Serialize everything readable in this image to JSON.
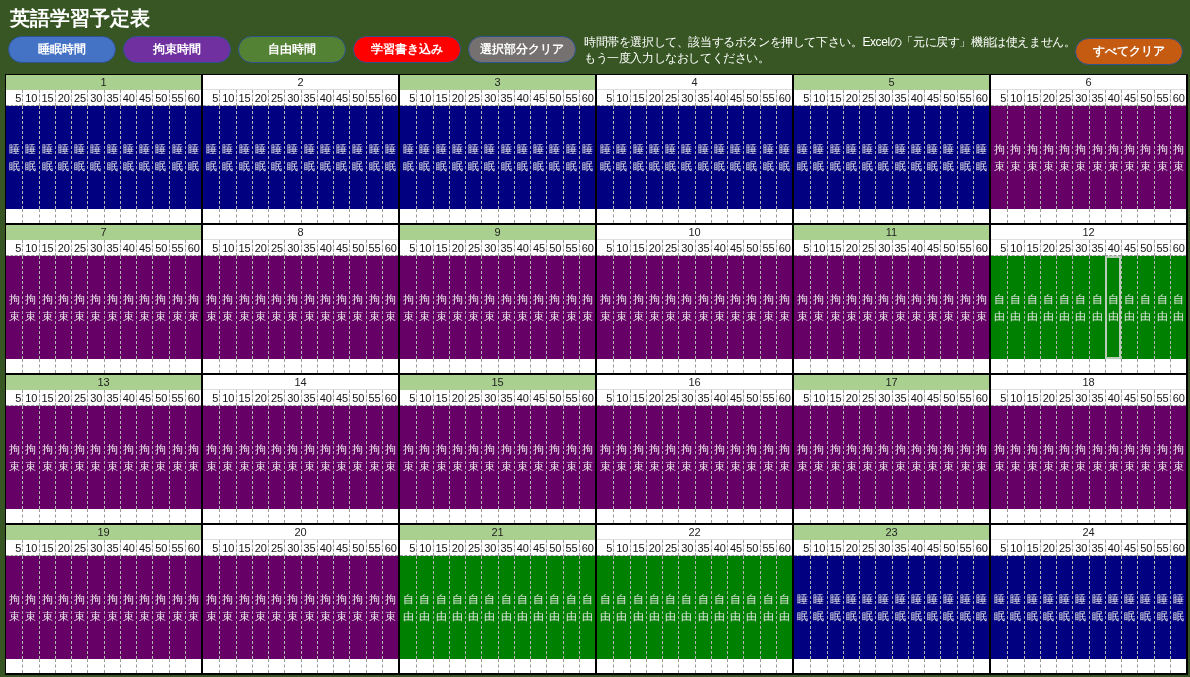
{
  "title": "英語学習予定表",
  "buttons": [
    {
      "label": "睡眠時間",
      "color": "#4472c4"
    },
    {
      "label": "拘束時間",
      "color": "#7030a0"
    },
    {
      "label": "自由時間",
      "color": "#548235"
    },
    {
      "label": "学習書き込み",
      "color": "#ff0000"
    },
    {
      "label": "選択部分クリア",
      "color": "#767171"
    }
  ],
  "instructions": [
    "時間帯を選択して、該当するボタンを押して下さい。Excelの「元に戻す」機能は使えません。",
    "もう一度入力しなおしてください。"
  ],
  "clear_all_button": {
    "label": "すべてクリア"
  },
  "hours": [
    {
      "hour": "1",
      "minutes": [
        "5",
        "10",
        "15",
        "20",
        "25",
        "30",
        "35",
        "40",
        "45",
        "50",
        "55",
        "60"
      ],
      "slots": [
        {
          "kind": "sleep",
          "text": "睡眠",
          "selected": false
        },
        {
          "kind": "sleep",
          "text": "睡眠",
          "selected": false
        },
        {
          "kind": "sleep",
          "text": "睡眠",
          "selected": false
        },
        {
          "kind": "sleep",
          "text": "睡眠",
          "selected": false
        },
        {
          "kind": "sleep",
          "text": "睡眠",
          "selected": false
        },
        {
          "kind": "sleep",
          "text": "睡眠",
          "selected": false
        },
        {
          "kind": "sleep",
          "text": "睡眠",
          "selected": false
        },
        {
          "kind": "sleep",
          "text": "睡眠",
          "selected": false
        },
        {
          "kind": "sleep",
          "text": "睡眠",
          "selected": false
        },
        {
          "kind": "sleep",
          "text": "睡眠",
          "selected": false
        },
        {
          "kind": "sleep",
          "text": "睡眠",
          "selected": false
        },
        {
          "kind": "sleep",
          "text": "睡眠",
          "selected": false
        }
      ]
    },
    {
      "hour": "2",
      "minutes": [
        "5",
        "10",
        "15",
        "20",
        "25",
        "30",
        "35",
        "40",
        "45",
        "50",
        "55",
        "60"
      ],
      "slots": [
        {
          "kind": "sleep",
          "text": "睡眠",
          "selected": false
        },
        {
          "kind": "sleep",
          "text": "睡眠",
          "selected": false
        },
        {
          "kind": "sleep",
          "text": "睡眠",
          "selected": false
        },
        {
          "kind": "sleep",
          "text": "睡眠",
          "selected": false
        },
        {
          "kind": "sleep",
          "text": "睡眠",
          "selected": false
        },
        {
          "kind": "sleep",
          "text": "睡眠",
          "selected": false
        },
        {
          "kind": "sleep",
          "text": "睡眠",
          "selected": false
        },
        {
          "kind": "sleep",
          "text": "睡眠",
          "selected": false
        },
        {
          "kind": "sleep",
          "text": "睡眠",
          "selected": false
        },
        {
          "kind": "sleep",
          "text": "睡眠",
          "selected": false
        },
        {
          "kind": "sleep",
          "text": "睡眠",
          "selected": false
        },
        {
          "kind": "sleep",
          "text": "睡眠",
          "selected": false
        }
      ]
    },
    {
      "hour": "3",
      "minutes": [
        "5",
        "10",
        "15",
        "20",
        "25",
        "30",
        "35",
        "40",
        "45",
        "50",
        "55",
        "60"
      ],
      "slots": [
        {
          "kind": "sleep",
          "text": "睡眠",
          "selected": false
        },
        {
          "kind": "sleep",
          "text": "睡眠",
          "selected": false
        },
        {
          "kind": "sleep",
          "text": "睡眠",
          "selected": false
        },
        {
          "kind": "sleep",
          "text": "睡眠",
          "selected": false
        },
        {
          "kind": "sleep",
          "text": "睡眠",
          "selected": false
        },
        {
          "kind": "sleep",
          "text": "睡眠",
          "selected": false
        },
        {
          "kind": "sleep",
          "text": "睡眠",
          "selected": false
        },
        {
          "kind": "sleep",
          "text": "睡眠",
          "selected": false
        },
        {
          "kind": "sleep",
          "text": "睡眠",
          "selected": false
        },
        {
          "kind": "sleep",
          "text": "睡眠",
          "selected": false
        },
        {
          "kind": "sleep",
          "text": "睡眠",
          "selected": false
        },
        {
          "kind": "sleep",
          "text": "睡眠",
          "selected": false
        }
      ]
    },
    {
      "hour": "4",
      "minutes": [
        "5",
        "10",
        "15",
        "20",
        "25",
        "30",
        "35",
        "40",
        "45",
        "50",
        "55",
        "60"
      ],
      "slots": [
        {
          "kind": "sleep",
          "text": "睡眠",
          "selected": false
        },
        {
          "kind": "sleep",
          "text": "睡眠",
          "selected": false
        },
        {
          "kind": "sleep",
          "text": "睡眠",
          "selected": false
        },
        {
          "kind": "sleep",
          "text": "睡眠",
          "selected": false
        },
        {
          "kind": "sleep",
          "text": "睡眠",
          "selected": false
        },
        {
          "kind": "sleep",
          "text": "睡眠",
          "selected": false
        },
        {
          "kind": "sleep",
          "text": "睡眠",
          "selected": false
        },
        {
          "kind": "sleep",
          "text": "睡眠",
          "selected": false
        },
        {
          "kind": "sleep",
          "text": "睡眠",
          "selected": false
        },
        {
          "kind": "sleep",
          "text": "睡眠",
          "selected": false
        },
        {
          "kind": "sleep",
          "text": "睡眠",
          "selected": false
        },
        {
          "kind": "sleep",
          "text": "睡眠",
          "selected": false
        }
      ]
    },
    {
      "hour": "5",
      "minutes": [
        "5",
        "10",
        "15",
        "20",
        "25",
        "30",
        "35",
        "40",
        "45",
        "50",
        "55",
        "60"
      ],
      "slots": [
        {
          "kind": "sleep",
          "text": "睡眠",
          "selected": false
        },
        {
          "kind": "sleep",
          "text": "睡眠",
          "selected": false
        },
        {
          "kind": "sleep",
          "text": "睡眠",
          "selected": false
        },
        {
          "kind": "sleep",
          "text": "睡眠",
          "selected": false
        },
        {
          "kind": "sleep",
          "text": "睡眠",
          "selected": false
        },
        {
          "kind": "sleep",
          "text": "睡眠",
          "selected": false
        },
        {
          "kind": "sleep",
          "text": "睡眠",
          "selected": false
        },
        {
          "kind": "sleep",
          "text": "睡眠",
          "selected": false
        },
        {
          "kind": "sleep",
          "text": "睡眠",
          "selected": false
        },
        {
          "kind": "sleep",
          "text": "睡眠",
          "selected": false
        },
        {
          "kind": "sleep",
          "text": "睡眠",
          "selected": false
        },
        {
          "kind": "sleep",
          "text": "睡眠",
          "selected": false
        }
      ]
    },
    {
      "hour": "6",
      "minutes": [
        "5",
        "10",
        "15",
        "20",
        "25",
        "30",
        "35",
        "40",
        "45",
        "50",
        "55",
        "60"
      ],
      "slots": [
        {
          "kind": "restraint",
          "text": "拘束",
          "selected": false
        },
        {
          "kind": "restraint",
          "text": "拘束",
          "selected": false
        },
        {
          "kind": "restraint",
          "text": "拘束",
          "selected": false
        },
        {
          "kind": "restraint",
          "text": "拘束",
          "selected": false
        },
        {
          "kind": "restraint",
          "text": "拘束",
          "selected": false
        },
        {
          "kind": "restraint",
          "text": "拘束",
          "selected": false
        },
        {
          "kind": "restraint",
          "text": "拘束",
          "selected": false
        },
        {
          "kind": "restraint",
          "text": "拘束",
          "selected": false
        },
        {
          "kind": "restraint",
          "text": "拘束",
          "selected": false
        },
        {
          "kind": "restraint",
          "text": "拘束",
          "selected": false
        },
        {
          "kind": "restraint",
          "text": "拘束",
          "selected": false
        },
        {
          "kind": "restraint",
          "text": "拘束",
          "selected": false
        }
      ]
    },
    {
      "hour": "7",
      "minutes": [
        "5",
        "10",
        "15",
        "20",
        "25",
        "30",
        "35",
        "40",
        "45",
        "50",
        "55",
        "60"
      ],
      "slots": [
        {
          "kind": "restraint",
          "text": "拘束",
          "selected": false
        },
        {
          "kind": "restraint",
          "text": "拘束",
          "selected": false
        },
        {
          "kind": "restraint",
          "text": "拘束",
          "selected": false
        },
        {
          "kind": "restraint",
          "text": "拘束",
          "selected": false
        },
        {
          "kind": "restraint",
          "text": "拘束",
          "selected": false
        },
        {
          "kind": "restraint",
          "text": "拘束",
          "selected": false
        },
        {
          "kind": "restraint",
          "text": "拘束",
          "selected": false
        },
        {
          "kind": "restraint",
          "text": "拘束",
          "selected": false
        },
        {
          "kind": "restraint",
          "text": "拘束",
          "selected": false
        },
        {
          "kind": "restraint",
          "text": "拘束",
          "selected": false
        },
        {
          "kind": "restraint",
          "text": "拘束",
          "selected": false
        },
        {
          "kind": "restraint",
          "text": "拘束",
          "selected": false
        }
      ]
    },
    {
      "hour": "8",
      "minutes": [
        "5",
        "10",
        "15",
        "20",
        "25",
        "30",
        "35",
        "40",
        "45",
        "50",
        "55",
        "60"
      ],
      "slots": [
        {
          "kind": "restraint",
          "text": "拘束",
          "selected": false
        },
        {
          "kind": "restraint",
          "text": "拘束",
          "selected": false
        },
        {
          "kind": "restraint",
          "text": "拘束",
          "selected": false
        },
        {
          "kind": "restraint",
          "text": "拘束",
          "selected": false
        },
        {
          "kind": "restraint",
          "text": "拘束",
          "selected": false
        },
        {
          "kind": "restraint",
          "text": "拘束",
          "selected": false
        },
        {
          "kind": "restraint",
          "text": "拘束",
          "selected": false
        },
        {
          "kind": "restraint",
          "text": "拘束",
          "selected": false
        },
        {
          "kind": "restraint",
          "text": "拘束",
          "selected": false
        },
        {
          "kind": "restraint",
          "text": "拘束",
          "selected": false
        },
        {
          "kind": "restraint",
          "text": "拘束",
          "selected": false
        },
        {
          "kind": "restraint",
          "text": "拘束",
          "selected": false
        }
      ]
    },
    {
      "hour": "9",
      "minutes": [
        "5",
        "10",
        "15",
        "20",
        "25",
        "30",
        "35",
        "40",
        "45",
        "50",
        "55",
        "60"
      ],
      "slots": [
        {
          "kind": "restraint",
          "text": "拘束",
          "selected": false
        },
        {
          "kind": "restraint",
          "text": "拘束",
          "selected": false
        },
        {
          "kind": "restraint",
          "text": "拘束",
          "selected": false
        },
        {
          "kind": "restraint",
          "text": "拘束",
          "selected": false
        },
        {
          "kind": "restraint",
          "text": "拘束",
          "selected": false
        },
        {
          "kind": "restraint",
          "text": "拘束",
          "selected": false
        },
        {
          "kind": "restraint",
          "text": "拘束",
          "selected": false
        },
        {
          "kind": "restraint",
          "text": "拘束",
          "selected": false
        },
        {
          "kind": "restraint",
          "text": "拘束",
          "selected": false
        },
        {
          "kind": "restraint",
          "text": "拘束",
          "selected": false
        },
        {
          "kind": "restraint",
          "text": "拘束",
          "selected": false
        },
        {
          "kind": "restraint",
          "text": "拘束",
          "selected": false
        }
      ]
    },
    {
      "hour": "10",
      "minutes": [
        "5",
        "10",
        "15",
        "20",
        "25",
        "30",
        "35",
        "40",
        "45",
        "50",
        "55",
        "60"
      ],
      "slots": [
        {
          "kind": "restraint",
          "text": "拘束",
          "selected": false
        },
        {
          "kind": "restraint",
          "text": "拘束",
          "selected": false
        },
        {
          "kind": "restraint",
          "text": "拘束",
          "selected": false
        },
        {
          "kind": "restraint",
          "text": "拘束",
          "selected": false
        },
        {
          "kind": "restraint",
          "text": "拘束",
          "selected": false
        },
        {
          "kind": "restraint",
          "text": "拘束",
          "selected": false
        },
        {
          "kind": "restraint",
          "text": "拘束",
          "selected": false
        },
        {
          "kind": "restraint",
          "text": "拘束",
          "selected": false
        },
        {
          "kind": "restraint",
          "text": "拘束",
          "selected": false
        },
        {
          "kind": "restraint",
          "text": "拘束",
          "selected": false
        },
        {
          "kind": "restraint",
          "text": "拘束",
          "selected": false
        },
        {
          "kind": "restraint",
          "text": "拘束",
          "selected": false
        }
      ]
    },
    {
      "hour": "11",
      "minutes": [
        "5",
        "10",
        "15",
        "20",
        "25",
        "30",
        "35",
        "40",
        "45",
        "50",
        "55",
        "60"
      ],
      "slots": [
        {
          "kind": "restraint",
          "text": "拘束",
          "selected": false
        },
        {
          "kind": "restraint",
          "text": "拘束",
          "selected": false
        },
        {
          "kind": "restraint",
          "text": "拘束",
          "selected": false
        },
        {
          "kind": "restraint",
          "text": "拘束",
          "selected": false
        },
        {
          "kind": "restraint",
          "text": "拘束",
          "selected": false
        },
        {
          "kind": "restraint",
          "text": "拘束",
          "selected": false
        },
        {
          "kind": "restraint",
          "text": "拘束",
          "selected": false
        },
        {
          "kind": "restraint",
          "text": "拘束",
          "selected": false
        },
        {
          "kind": "restraint",
          "text": "拘束",
          "selected": false
        },
        {
          "kind": "restraint",
          "text": "拘束",
          "selected": false
        },
        {
          "kind": "restraint",
          "text": "拘束",
          "selected": false
        },
        {
          "kind": "restraint",
          "text": "拘束",
          "selected": false
        }
      ]
    },
    {
      "hour": "12",
      "minutes": [
        "5",
        "10",
        "15",
        "20",
        "25",
        "30",
        "35",
        "40",
        "45",
        "50",
        "55",
        "60"
      ],
      "slots": [
        {
          "kind": "free",
          "text": "自由",
          "selected": false
        },
        {
          "kind": "free",
          "text": "自由",
          "selected": false
        },
        {
          "kind": "free",
          "text": "自由",
          "selected": false
        },
        {
          "kind": "free",
          "text": "自由",
          "selected": false
        },
        {
          "kind": "free",
          "text": "自由",
          "selected": false
        },
        {
          "kind": "free",
          "text": "自由",
          "selected": false
        },
        {
          "kind": "free",
          "text": "自由",
          "selected": false
        },
        {
          "kind": "free",
          "text": "自由",
          "selected": true
        },
        {
          "kind": "free",
          "text": "自由",
          "selected": false
        },
        {
          "kind": "free",
          "text": "自由",
          "selected": false
        },
        {
          "kind": "free",
          "text": "自由",
          "selected": false
        },
        {
          "kind": "free",
          "text": "自由",
          "selected": false
        }
      ]
    },
    {
      "hour": "13",
      "minutes": [
        "5",
        "10",
        "15",
        "20",
        "25",
        "30",
        "35",
        "40",
        "45",
        "50",
        "55",
        "60"
      ],
      "slots": [
        {
          "kind": "restraint",
          "text": "拘束",
          "selected": false
        },
        {
          "kind": "restraint",
          "text": "拘束",
          "selected": false
        },
        {
          "kind": "restraint",
          "text": "拘束",
          "selected": false
        },
        {
          "kind": "restraint",
          "text": "拘束",
          "selected": false
        },
        {
          "kind": "restraint",
          "text": "拘束",
          "selected": false
        },
        {
          "kind": "restraint",
          "text": "拘束",
          "selected": false
        },
        {
          "kind": "restraint",
          "text": "拘束",
          "selected": false
        },
        {
          "kind": "restraint",
          "text": "拘束",
          "selected": false
        },
        {
          "kind": "restraint",
          "text": "拘束",
          "selected": false
        },
        {
          "kind": "restraint",
          "text": "拘束",
          "selected": false
        },
        {
          "kind": "restraint",
          "text": "拘束",
          "selected": false
        },
        {
          "kind": "restraint",
          "text": "拘束",
          "selected": false
        }
      ]
    },
    {
      "hour": "14",
      "minutes": [
        "5",
        "10",
        "15",
        "20",
        "25",
        "30",
        "35",
        "40",
        "45",
        "50",
        "55",
        "60"
      ],
      "slots": [
        {
          "kind": "restraint",
          "text": "拘束",
          "selected": false
        },
        {
          "kind": "restraint",
          "text": "拘束",
          "selected": false
        },
        {
          "kind": "restraint",
          "text": "拘束",
          "selected": false
        },
        {
          "kind": "restraint",
          "text": "拘束",
          "selected": false
        },
        {
          "kind": "restraint",
          "text": "拘束",
          "selected": false
        },
        {
          "kind": "restraint",
          "text": "拘束",
          "selected": false
        },
        {
          "kind": "restraint",
          "text": "拘束",
          "selected": false
        },
        {
          "kind": "restraint",
          "text": "拘束",
          "selected": false
        },
        {
          "kind": "restraint",
          "text": "拘束",
          "selected": false
        },
        {
          "kind": "restraint",
          "text": "拘束",
          "selected": false
        },
        {
          "kind": "restraint",
          "text": "拘束",
          "selected": false
        },
        {
          "kind": "restraint",
          "text": "拘束",
          "selected": false
        }
      ]
    },
    {
      "hour": "15",
      "minutes": [
        "5",
        "10",
        "15",
        "20",
        "25",
        "30",
        "35",
        "40",
        "45",
        "50",
        "55",
        "60"
      ],
      "slots": [
        {
          "kind": "restraint",
          "text": "拘束",
          "selected": false
        },
        {
          "kind": "restraint",
          "text": "拘束",
          "selected": false
        },
        {
          "kind": "restraint",
          "text": "拘束",
          "selected": false
        },
        {
          "kind": "restraint",
          "text": "拘束",
          "selected": false
        },
        {
          "kind": "restraint",
          "text": "拘束",
          "selected": false
        },
        {
          "kind": "restraint",
          "text": "拘束",
          "selected": false
        },
        {
          "kind": "restraint",
          "text": "拘束",
          "selected": false
        },
        {
          "kind": "restraint",
          "text": "拘束",
          "selected": false
        },
        {
          "kind": "restraint",
          "text": "拘束",
          "selected": false
        },
        {
          "kind": "restraint",
          "text": "拘束",
          "selected": false
        },
        {
          "kind": "restraint",
          "text": "拘束",
          "selected": false
        },
        {
          "kind": "restraint",
          "text": "拘束",
          "selected": false
        }
      ]
    },
    {
      "hour": "16",
      "minutes": [
        "5",
        "10",
        "15",
        "20",
        "25",
        "30",
        "35",
        "40",
        "45",
        "50",
        "55",
        "60"
      ],
      "slots": [
        {
          "kind": "restraint",
          "text": "拘束",
          "selected": false
        },
        {
          "kind": "restraint",
          "text": "拘束",
          "selected": false
        },
        {
          "kind": "restraint",
          "text": "拘束",
          "selected": false
        },
        {
          "kind": "restraint",
          "text": "拘束",
          "selected": false
        },
        {
          "kind": "restraint",
          "text": "拘束",
          "selected": false
        },
        {
          "kind": "restraint",
          "text": "拘束",
          "selected": false
        },
        {
          "kind": "restraint",
          "text": "拘束",
          "selected": false
        },
        {
          "kind": "restraint",
          "text": "拘束",
          "selected": false
        },
        {
          "kind": "restraint",
          "text": "拘束",
          "selected": false
        },
        {
          "kind": "restraint",
          "text": "拘束",
          "selected": false
        },
        {
          "kind": "restraint",
          "text": "拘束",
          "selected": false
        },
        {
          "kind": "restraint",
          "text": "拘束",
          "selected": false
        }
      ]
    },
    {
      "hour": "17",
      "minutes": [
        "5",
        "10",
        "15",
        "20",
        "25",
        "30",
        "35",
        "40",
        "45",
        "50",
        "55",
        "60"
      ],
      "slots": [
        {
          "kind": "restraint",
          "text": "拘束",
          "selected": false
        },
        {
          "kind": "restraint",
          "text": "拘束",
          "selected": false
        },
        {
          "kind": "restraint",
          "text": "拘束",
          "selected": false
        },
        {
          "kind": "restraint",
          "text": "拘束",
          "selected": false
        },
        {
          "kind": "restraint",
          "text": "拘束",
          "selected": false
        },
        {
          "kind": "restraint",
          "text": "拘束",
          "selected": false
        },
        {
          "kind": "restraint",
          "text": "拘束",
          "selected": false
        },
        {
          "kind": "restraint",
          "text": "拘束",
          "selected": false
        },
        {
          "kind": "restraint",
          "text": "拘束",
          "selected": false
        },
        {
          "kind": "restraint",
          "text": "拘束",
          "selected": false
        },
        {
          "kind": "restraint",
          "text": "拘束",
          "selected": false
        },
        {
          "kind": "restraint",
          "text": "拘束",
          "selected": false
        }
      ]
    },
    {
      "hour": "18",
      "minutes": [
        "5",
        "10",
        "15",
        "20",
        "25",
        "30",
        "35",
        "40",
        "45",
        "50",
        "55",
        "60"
      ],
      "slots": [
        {
          "kind": "restraint",
          "text": "拘束",
          "selected": false
        },
        {
          "kind": "restraint",
          "text": "拘束",
          "selected": false
        },
        {
          "kind": "restraint",
          "text": "拘束",
          "selected": false
        },
        {
          "kind": "restraint",
          "text": "拘束",
          "selected": false
        },
        {
          "kind": "restraint",
          "text": "拘束",
          "selected": false
        },
        {
          "kind": "restraint",
          "text": "拘束",
          "selected": false
        },
        {
          "kind": "restraint",
          "text": "拘束",
          "selected": false
        },
        {
          "kind": "restraint",
          "text": "拘束",
          "selected": false
        },
        {
          "kind": "restraint",
          "text": "拘束",
          "selected": false
        },
        {
          "kind": "restraint",
          "text": "拘束",
          "selected": false
        },
        {
          "kind": "restraint",
          "text": "拘束",
          "selected": false
        },
        {
          "kind": "restraint",
          "text": "拘束",
          "selected": false
        }
      ]
    },
    {
      "hour": "19",
      "minutes": [
        "5",
        "10",
        "15",
        "20",
        "25",
        "30",
        "35",
        "40",
        "45",
        "50",
        "55",
        "60"
      ],
      "slots": [
        {
          "kind": "restraint",
          "text": "拘束",
          "selected": false
        },
        {
          "kind": "restraint",
          "text": "拘束",
          "selected": false
        },
        {
          "kind": "restraint",
          "text": "拘束",
          "selected": false
        },
        {
          "kind": "restraint",
          "text": "拘束",
          "selected": false
        },
        {
          "kind": "restraint",
          "text": "拘束",
          "selected": false
        },
        {
          "kind": "restraint",
          "text": "拘束",
          "selected": false
        },
        {
          "kind": "restraint",
          "text": "拘束",
          "selected": false
        },
        {
          "kind": "restraint",
          "text": "拘束",
          "selected": false
        },
        {
          "kind": "restraint",
          "text": "拘束",
          "selected": false
        },
        {
          "kind": "restraint",
          "text": "拘束",
          "selected": false
        },
        {
          "kind": "restraint",
          "text": "拘束",
          "selected": false
        },
        {
          "kind": "restraint",
          "text": "拘束",
          "selected": false
        }
      ]
    },
    {
      "hour": "20",
      "minutes": [
        "5",
        "10",
        "15",
        "20",
        "25",
        "30",
        "35",
        "40",
        "45",
        "50",
        "55",
        "60"
      ],
      "slots": [
        {
          "kind": "restraint",
          "text": "拘束",
          "selected": false
        },
        {
          "kind": "restraint",
          "text": "拘束",
          "selected": false
        },
        {
          "kind": "restraint",
          "text": "拘束",
          "selected": false
        },
        {
          "kind": "restraint",
          "text": "拘束",
          "selected": false
        },
        {
          "kind": "restraint",
          "text": "拘束",
          "selected": false
        },
        {
          "kind": "restraint",
          "text": "拘束",
          "selected": false
        },
        {
          "kind": "restraint",
          "text": "拘束",
          "selected": false
        },
        {
          "kind": "restraint",
          "text": "拘束",
          "selected": false
        },
        {
          "kind": "restraint",
          "text": "拘束",
          "selected": false
        },
        {
          "kind": "restraint",
          "text": "拘束",
          "selected": false
        },
        {
          "kind": "restraint",
          "text": "拘束",
          "selected": false
        },
        {
          "kind": "restraint",
          "text": "拘束",
          "selected": false
        }
      ]
    },
    {
      "hour": "21",
      "minutes": [
        "5",
        "10",
        "15",
        "20",
        "25",
        "30",
        "35",
        "40",
        "45",
        "50",
        "55",
        "60"
      ],
      "slots": [
        {
          "kind": "free",
          "text": "自由",
          "selected": false
        },
        {
          "kind": "free",
          "text": "自由",
          "selected": false
        },
        {
          "kind": "free",
          "text": "自由",
          "selected": false
        },
        {
          "kind": "free",
          "text": "自由",
          "selected": false
        },
        {
          "kind": "free",
          "text": "自由",
          "selected": false
        },
        {
          "kind": "free",
          "text": "自由",
          "selected": false
        },
        {
          "kind": "free",
          "text": "自由",
          "selected": false
        },
        {
          "kind": "free",
          "text": "自由",
          "selected": false
        },
        {
          "kind": "free",
          "text": "自由",
          "selected": false
        },
        {
          "kind": "free",
          "text": "自由",
          "selected": false
        },
        {
          "kind": "free",
          "text": "自由",
          "selected": false
        },
        {
          "kind": "free",
          "text": "自由",
          "selected": false
        }
      ]
    },
    {
      "hour": "22",
      "minutes": [
        "5",
        "10",
        "15",
        "20",
        "25",
        "30",
        "35",
        "40",
        "45",
        "50",
        "55",
        "60"
      ],
      "slots": [
        {
          "kind": "free",
          "text": "自由",
          "selected": false
        },
        {
          "kind": "free",
          "text": "自由",
          "selected": false
        },
        {
          "kind": "free",
          "text": "自由",
          "selected": false
        },
        {
          "kind": "free",
          "text": "自由",
          "selected": false
        },
        {
          "kind": "free",
          "text": "自由",
          "selected": false
        },
        {
          "kind": "free",
          "text": "自由",
          "selected": false
        },
        {
          "kind": "free",
          "text": "自由",
          "selected": false
        },
        {
          "kind": "free",
          "text": "自由",
          "selected": false
        },
        {
          "kind": "free",
          "text": "自由",
          "selected": false
        },
        {
          "kind": "free",
          "text": "自由",
          "selected": false
        },
        {
          "kind": "free",
          "text": "自由",
          "selected": false
        },
        {
          "kind": "free",
          "text": "自由",
          "selected": false
        }
      ]
    },
    {
      "hour": "23",
      "minutes": [
        "5",
        "10",
        "15",
        "20",
        "25",
        "30",
        "35",
        "40",
        "45",
        "50",
        "55",
        "60"
      ],
      "slots": [
        {
          "kind": "sleep",
          "text": "睡眠",
          "selected": false
        },
        {
          "kind": "sleep",
          "text": "睡眠",
          "selected": false
        },
        {
          "kind": "sleep",
          "text": "睡眠",
          "selected": false
        },
        {
          "kind": "sleep",
          "text": "睡眠",
          "selected": false
        },
        {
          "kind": "sleep",
          "text": "睡眠",
          "selected": false
        },
        {
          "kind": "sleep",
          "text": "睡眠",
          "selected": false
        },
        {
          "kind": "sleep",
          "text": "睡眠",
          "selected": false
        },
        {
          "kind": "sleep",
          "text": "睡眠",
          "selected": false
        },
        {
          "kind": "sleep",
          "text": "睡眠",
          "selected": false
        },
        {
          "kind": "sleep",
          "text": "睡眠",
          "selected": false
        },
        {
          "kind": "sleep",
          "text": "睡眠",
          "selected": false
        },
        {
          "kind": "sleep",
          "text": "睡眠",
          "selected": false
        }
      ]
    },
    {
      "hour": "24",
      "minutes": [
        "5",
        "10",
        "15",
        "20",
        "25",
        "30",
        "35",
        "40",
        "45",
        "50",
        "55",
        "60"
      ],
      "slots": [
        {
          "kind": "sleep",
          "text": "睡眠",
          "selected": false
        },
        {
          "kind": "sleep",
          "text": "睡眠",
          "selected": false
        },
        {
          "kind": "sleep",
          "text": "睡眠",
          "selected": false
        },
        {
          "kind": "sleep",
          "text": "睡眠",
          "selected": false
        },
        {
          "kind": "sleep",
          "text": "睡眠",
          "selected": false
        },
        {
          "kind": "sleep",
          "text": "睡眠",
          "selected": false
        },
        {
          "kind": "sleep",
          "text": "睡眠",
          "selected": false
        },
        {
          "kind": "sleep",
          "text": "睡眠",
          "selected": false
        },
        {
          "kind": "sleep",
          "text": "睡眠",
          "selected": false
        },
        {
          "kind": "sleep",
          "text": "睡眠",
          "selected": false
        },
        {
          "kind": "sleep",
          "text": "睡眠",
          "selected": false
        },
        {
          "kind": "sleep",
          "text": "睡眠",
          "selected": false
        }
      ]
    }
  ]
}
